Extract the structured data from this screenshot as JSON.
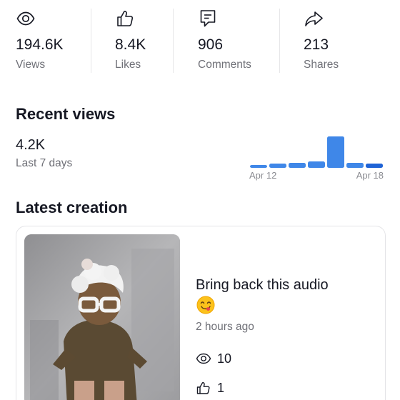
{
  "stats": [
    {
      "icon": "eye-icon",
      "value": "194.6K",
      "label": "Views"
    },
    {
      "icon": "thumbs-up-icon",
      "value": "8.4K",
      "label": "Likes"
    },
    {
      "icon": "comment-icon",
      "value": "906",
      "label": "Comments"
    },
    {
      "icon": "share-arrow-icon",
      "value": "213",
      "label": "Shares"
    }
  ],
  "recent_views": {
    "title": "Recent views",
    "value": "4.2K",
    "period": "Last 7 days"
  },
  "chart_data": {
    "type": "bar",
    "categories": [
      "Apr 12",
      "Apr 13",
      "Apr 14",
      "Apr 15",
      "Apr 16",
      "Apr 17",
      "Apr 18"
    ],
    "tick_labels": [
      "Apr 12",
      "Apr 18"
    ],
    "values": [
      4,
      6,
      7,
      9,
      44,
      7,
      6
    ],
    "ylim": [
      0,
      45
    ],
    "colors": [
      "#3f87e8",
      "#3f87e8",
      "#3f87e8",
      "#3f87e8",
      "#3f87e8",
      "#3f87e8",
      "#1f63d6"
    ],
    "grid": false,
    "title": "",
    "xlabel": "",
    "ylabel": ""
  },
  "latest_creation": {
    "title": "Latest creation",
    "video_title": "Bring back this audio",
    "emoji": "face-savoring-food-emoji",
    "time_ago": "2 hours ago",
    "views": "10",
    "likes": "1"
  },
  "colors": {
    "text_primary": "#161823",
    "text_secondary": "#6f7077",
    "bar": "#3f87e8",
    "bar_last": "#1f63d6",
    "divider": "#e6e6e8"
  }
}
